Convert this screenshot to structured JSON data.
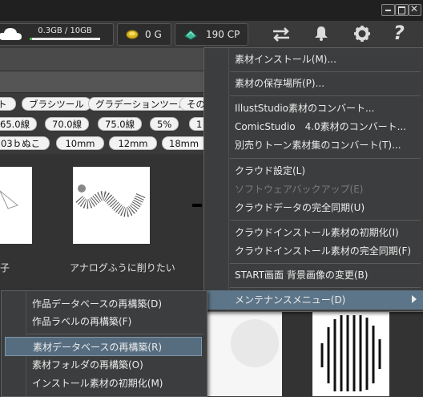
{
  "toolbar": {
    "storage_text": "0.3GB / 10GB",
    "storage_fraction": 0.03,
    "gold_text": "0 G",
    "cp_text": "190 CP"
  },
  "tags": {
    "row1": [
      "ト",
      "ブラシツール",
      "グラデーションツール",
      "その"
    ],
    "row2": [
      "65.0線",
      "70.0線",
      "75.0線",
      "5%",
      "1"
    ],
    "row3": [
      "03ｂぬこ",
      "10mm",
      "12mm",
      "18mm"
    ]
  },
  "thumbs": {
    "caption1": "子",
    "caption2": "アナログふうに削りたい"
  },
  "main_menu": {
    "items": [
      "素材インストール(M)...",
      "素材の保存場所(P)...",
      "IllustStudio素材のコンバート...",
      "ComicStudio　4.0素材のコンバート...",
      "別売りトーン素材集のコンバート(T)...",
      "クラウド設定(L)",
      "ソフトウェアバックアップ(E)",
      "クラウドデータの完全同期(U)",
      "クラウドインストール素材の初期化(I)",
      "クラウドインストール素材の完全同期(F)",
      "START画面  背景画像の変更(B)",
      "メンテナンスメニュー(D)"
    ]
  },
  "sub_menu": {
    "items": [
      "作品データベースの再構築(D)",
      "作品ラベルの再構築(F)",
      "素材データベースの再構築(R)",
      "素材フォルダの再構築(O)",
      "インストール素材の初期化(M)"
    ]
  }
}
